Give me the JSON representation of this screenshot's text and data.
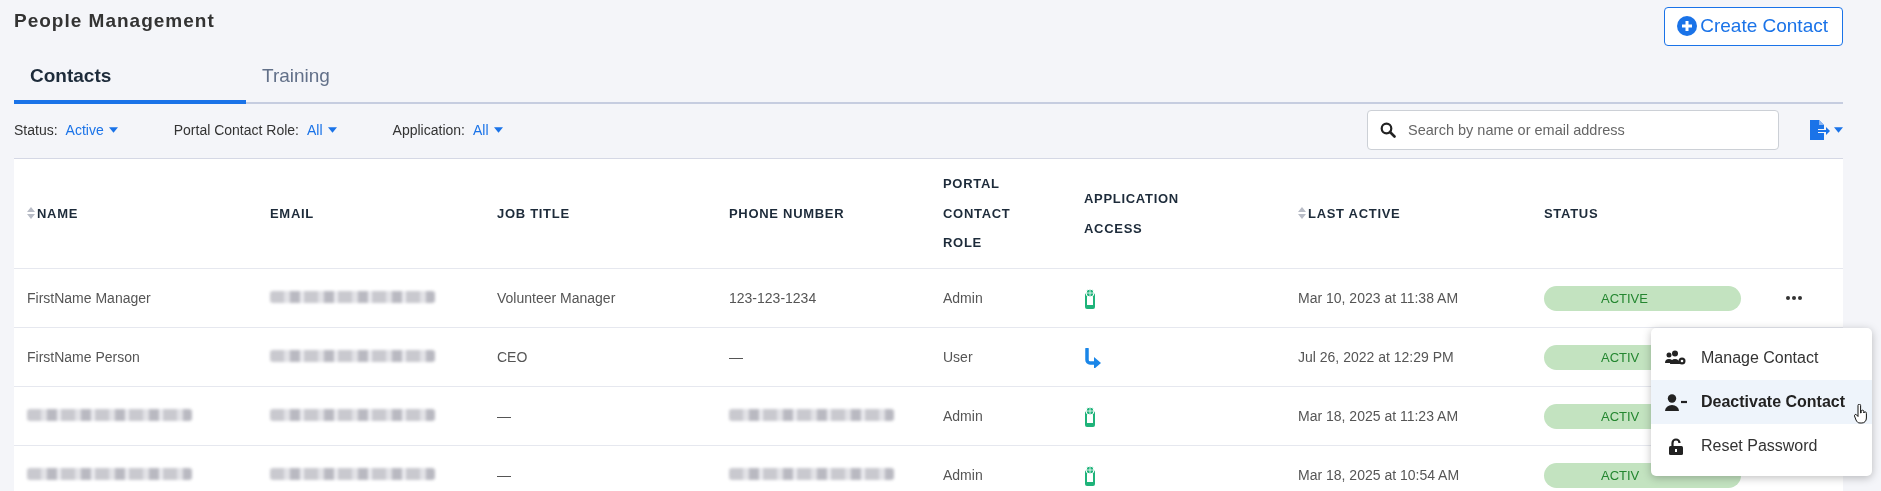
{
  "page": {
    "title": "People Management"
  },
  "create_button": {
    "label": "Create Contact"
  },
  "tabs": [
    {
      "label": "Contacts",
      "selected": true
    },
    {
      "label": "Training",
      "selected": false
    }
  ],
  "filters": [
    {
      "label": "Status:",
      "value": "Active"
    },
    {
      "label": "Portal Contact Role:",
      "value": "All"
    },
    {
      "label": "Application:",
      "value": "All"
    }
  ],
  "search": {
    "placeholder": "Search by name or email address"
  },
  "table": {
    "columns": [
      {
        "label": "NAME",
        "sortable": true
      },
      {
        "label": "EMAIL",
        "sortable": false
      },
      {
        "label": "JOB TITLE",
        "sortable": false
      },
      {
        "label": "PHONE NUMBER",
        "sortable": false
      },
      {
        "label": "PORTAL CONTACT ROLE",
        "sortable": false
      },
      {
        "label": "APPLICATION ACCESS",
        "sortable": false
      },
      {
        "label": "LAST ACTIVE",
        "sortable": true
      },
      {
        "label": "STATUS",
        "sortable": false
      }
    ],
    "rows": [
      {
        "name": {
          "text": "FirstName Manager"
        },
        "email": {
          "redacted": true
        },
        "job_title": {
          "text": "Volunteer Manager"
        },
        "phone": {
          "text": "123-123-1234"
        },
        "portal_role": {
          "text": "Admin"
        },
        "app_access": {
          "kind": "mobile"
        },
        "last_active": {
          "text": "Mar 10, 2023 at 11:38 AM"
        },
        "status": {
          "kind": "active",
          "text": "ACTIVE"
        },
        "actions_button": true
      },
      {
        "name": {
          "text": "FirstName Person"
        },
        "email": {
          "redacted": true
        },
        "job_title": {
          "text": "CEO"
        },
        "phone": {
          "text": "—"
        },
        "portal_role": {
          "text": "User"
        },
        "app_access": {
          "kind": "arrow"
        },
        "last_active": {
          "text": "Jul 26, 2022 at 12:29 PM"
        },
        "status": {
          "kind": "active",
          "text": "ACTIV"
        },
        "actions_button": false
      },
      {
        "name": {
          "redacted": true
        },
        "email": {
          "redacted": true
        },
        "job_title": {
          "text": "—"
        },
        "phone": {
          "redacted": true
        },
        "portal_role": {
          "text": "Admin"
        },
        "app_access": {
          "kind": "mobile"
        },
        "last_active": {
          "text": "Mar 18, 2025 at 11:23 AM"
        },
        "status": {
          "kind": "active",
          "text": "ACTIV"
        },
        "actions_button": false
      },
      {
        "name": {
          "redacted": true
        },
        "email": {
          "redacted": true
        },
        "job_title": {
          "text": "—"
        },
        "phone": {
          "redacted": true
        },
        "portal_role": {
          "text": "Admin"
        },
        "app_access": {
          "kind": "mobile"
        },
        "last_active": {
          "text": "Mar 18, 2025 at 10:54 AM"
        },
        "status": {
          "kind": "active",
          "text": "ACTIV"
        },
        "actions_button": false
      }
    ]
  },
  "row_menu": {
    "items": [
      {
        "kind": "users-gear",
        "label": "Manage Contact",
        "highlighted": false
      },
      {
        "kind": "user-minus",
        "label": "Deactivate Contact",
        "highlighted": true
      },
      {
        "kind": "unlock",
        "label": "Reset Password",
        "highlighted": false
      }
    ]
  }
}
